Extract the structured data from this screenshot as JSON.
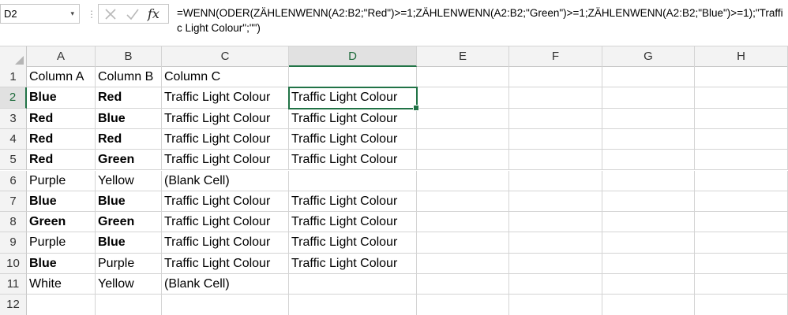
{
  "formula_bar": {
    "name_box": "D2",
    "caret": "▾",
    "splitter": "⋮",
    "fx_label": "fx",
    "formula": "=WENN(ODER(ZÄHLENWENN(A2:B2;\"Red\")>=1;ZÄHLENWENN(A2:B2;\"Green\")>=1;ZÄHLENWENN(A2:B2;\"Blue\")>=1);\"Traffic Light Colour\";\"\")"
  },
  "columns": [
    "A",
    "B",
    "C",
    "D",
    "E",
    "F",
    "G",
    "H"
  ],
  "active_column": "D",
  "active_row": 2,
  "rows": [
    {
      "n": "1",
      "cells": [
        {
          "v": "Column A",
          "b": false
        },
        {
          "v": "Column B",
          "b": false
        },
        {
          "v": "Column C",
          "b": false
        },
        {
          "v": "",
          "b": false
        }
      ]
    },
    {
      "n": "2",
      "cells": [
        {
          "v": "Blue",
          "b": true
        },
        {
          "v": "Red",
          "b": true
        },
        {
          "v": "Traffic Light Colour",
          "b": false
        },
        {
          "v": "Traffic Light Colour",
          "b": false
        }
      ]
    },
    {
      "n": "3",
      "cells": [
        {
          "v": "Red",
          "b": true
        },
        {
          "v": "Blue",
          "b": true
        },
        {
          "v": "Traffic Light Colour",
          "b": false
        },
        {
          "v": "Traffic Light Colour",
          "b": false
        }
      ]
    },
    {
      "n": "4",
      "cells": [
        {
          "v": "Red",
          "b": true
        },
        {
          "v": "Red",
          "b": true
        },
        {
          "v": "Traffic Light Colour",
          "b": false
        },
        {
          "v": "Traffic Light Colour",
          "b": false
        }
      ]
    },
    {
      "n": "5",
      "cells": [
        {
          "v": "Red",
          "b": true
        },
        {
          "v": "Green",
          "b": true
        },
        {
          "v": "Traffic Light Colour",
          "b": false
        },
        {
          "v": "Traffic Light Colour",
          "b": false
        }
      ]
    },
    {
      "n": "6",
      "cells": [
        {
          "v": "Purple",
          "b": false
        },
        {
          "v": "Yellow",
          "b": false
        },
        {
          "v": "(Blank Cell)",
          "b": false
        },
        {
          "v": "",
          "b": false
        }
      ]
    },
    {
      "n": "7",
      "cells": [
        {
          "v": "Blue",
          "b": true
        },
        {
          "v": "Blue",
          "b": true
        },
        {
          "v": "Traffic Light Colour",
          "b": false
        },
        {
          "v": "Traffic Light Colour",
          "b": false
        }
      ]
    },
    {
      "n": "8",
      "cells": [
        {
          "v": "Green",
          "b": true
        },
        {
          "v": "Green",
          "b": true
        },
        {
          "v": "Traffic Light Colour",
          "b": false
        },
        {
          "v": "Traffic Light Colour",
          "b": false
        }
      ]
    },
    {
      "n": "9",
      "cells": [
        {
          "v": "Purple",
          "b": false
        },
        {
          "v": "Blue",
          "b": true
        },
        {
          "v": "Traffic Light Colour",
          "b": false
        },
        {
          "v": "Traffic Light Colour",
          "b": false
        }
      ]
    },
    {
      "n": "10",
      "cells": [
        {
          "v": "Blue",
          "b": true
        },
        {
          "v": "Purple",
          "b": false
        },
        {
          "v": "Traffic Light Colour",
          "b": false
        },
        {
          "v": "Traffic Light Colour",
          "b": false
        }
      ]
    },
    {
      "n": "11",
      "cells": [
        {
          "v": "White",
          "b": false
        },
        {
          "v": "Yellow",
          "b": false
        },
        {
          "v": "(Blank Cell)",
          "b": false
        },
        {
          "v": "",
          "b": false
        }
      ]
    },
    {
      "n": "12",
      "cells": [
        {
          "v": "",
          "b": false
        },
        {
          "v": "",
          "b": false
        },
        {
          "v": "",
          "b": false
        },
        {
          "v": "",
          "b": false
        }
      ]
    }
  ],
  "colors": {
    "accent": "#217346",
    "header_bg": "#f3f3f3",
    "gridline": "#d4d4d4"
  }
}
